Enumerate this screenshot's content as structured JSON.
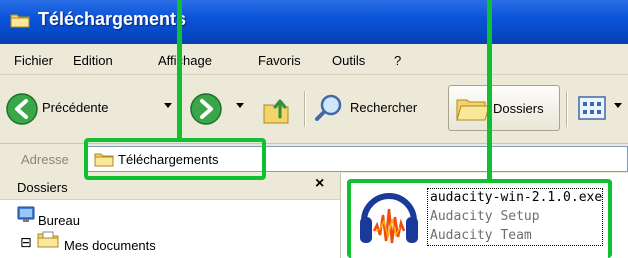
{
  "window": {
    "title": "Téléchargements"
  },
  "menu": [
    "Fichier",
    "Edition",
    "Affichage",
    "Favoris",
    "Outils",
    "?"
  ],
  "toolbar": {
    "back_label": "Précédente",
    "search_label": "Rechercher",
    "folders_label": "Dossiers"
  },
  "address": {
    "label": "Adresse",
    "value": "Téléchargements"
  },
  "folders_panel": {
    "title": "Dossiers",
    "close_symbol": "×",
    "items": [
      "Bureau",
      "Mes documents"
    ],
    "expander_symbol": "⊟"
  },
  "file": {
    "name": "audacity-win-2.1.0.exe",
    "description": "Audacity Setup",
    "company": "Audacity Team"
  },
  "colors": {
    "highlight": "#10c030",
    "titlebar": "#0a54d8",
    "chrome": "#ece9d8"
  }
}
